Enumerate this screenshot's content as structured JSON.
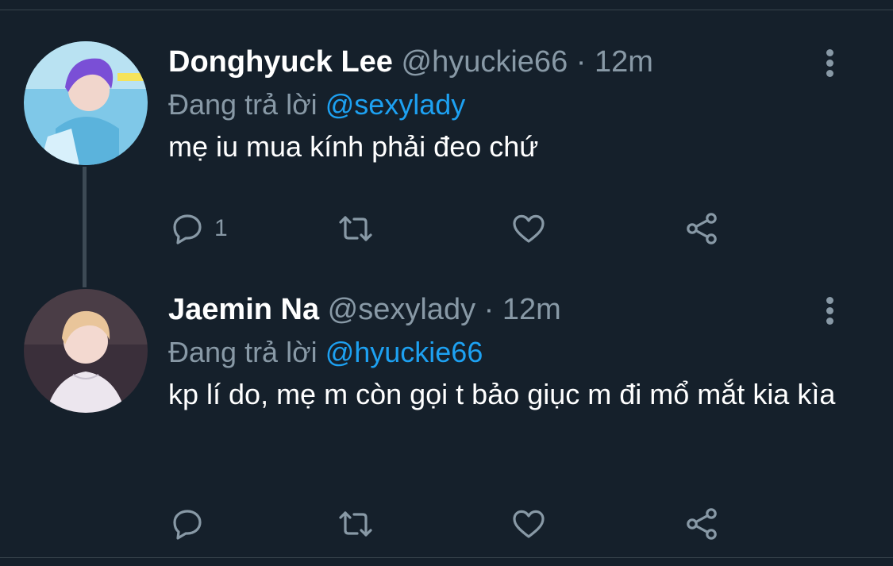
{
  "colors": {
    "background": "#15202b",
    "accent": "#1da1f2",
    "muted": "#8899a6",
    "divider": "#38444d"
  },
  "tweets": [
    {
      "name": "Donghyuck Lee",
      "handle": "@hyuckie66",
      "separator": "·",
      "time": "12m",
      "reply_prefix": "Đang trả lời",
      "reply_to": "@sexylady",
      "text": "mẹ iu mua kính phải đeo chứ",
      "reply_count": "1",
      "avatar": "profile-photo"
    },
    {
      "name": "Jaemin Na",
      "handle": "@sexylady",
      "separator": "·",
      "time": "12m",
      "reply_prefix": "Đang trả lời",
      "reply_to": "@hyuckie66",
      "text": "kp lí do, mẹ m còn gọi t bảo giục m đi mổ mắt kia kìa",
      "reply_count": "",
      "avatar": "profile-photo"
    }
  ],
  "icons": [
    "reply-icon",
    "retweet-icon",
    "like-icon",
    "share-icon",
    "more-icon"
  ]
}
